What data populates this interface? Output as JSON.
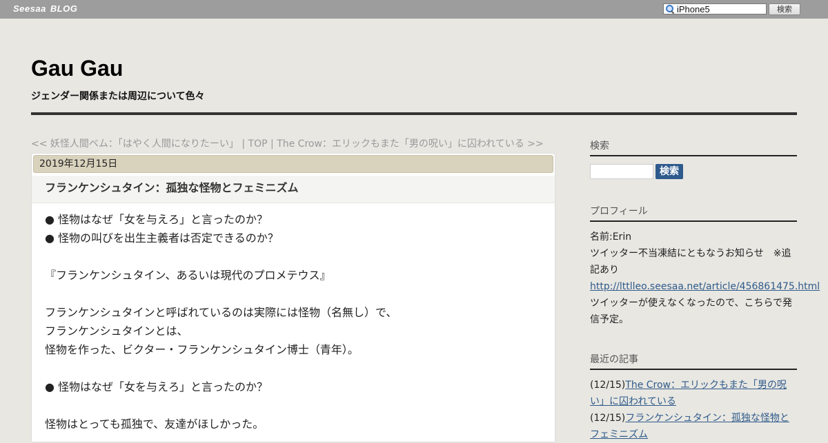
{
  "topbar": {
    "brand_word1": "Seesaa",
    "brand_word2": "BLOG",
    "search_value": "iPhone5",
    "search_button": "検索"
  },
  "header": {
    "title": "Gau Gau",
    "description": "ジェンダー関係または周辺について色々"
  },
  "article_nav": {
    "prev": "<< 妖怪人間ベム：「はやく人間になりたーい」",
    "sep1": " | ",
    "top": "TOP",
    "sep2": " | ",
    "next": "The Crow：エリックもまた「男の呪い」に囚われている >>"
  },
  "article": {
    "date": "2019年12月15日",
    "title": "フランケンシュタイン：孤独な怪物とフェミニズム",
    "body_lines": [
      "● 怪物はなぜ「女を与えろ」と言ったのか？",
      "● 怪物の叫びを出生主義者は否定できるのか？",
      "",
      "『フランケンシュタイン、あるいは現代のプロメテウス』",
      "",
      "フランケンシュタインと呼ばれているのは実際には怪物（名無し）で、",
      "フランケンシュタインとは、",
      "怪物を作った、ビクター・フランケンシュタイン博士（青年）。",
      "",
      "● 怪物はなぜ「女を与えろ」と言ったのか？",
      "",
      "怪物はとっても孤独で、友達がほしかった。"
    ]
  },
  "sidebar": {
    "search": {
      "heading": "検索",
      "button": "検索"
    },
    "profile": {
      "heading": "プロフィール",
      "name": "名前:Erin",
      "notice": "ツイッター不当凍結にともなうお知らせ　※追記あり",
      "link": "http://lttlleo.seesaa.net/article/456861475.html",
      "note": "ツイッターが使えなくなったので、こちらで発信予定。"
    },
    "recent": {
      "heading": "最近の記事",
      "items": [
        {
          "date": "(12/15)",
          "title": "The Crow：エリックもまた「男の呪い」に囚われている"
        },
        {
          "date": "(12/15)",
          "title": "フランケンシュタイン：孤独な怪物とフェミニズム"
        }
      ]
    }
  },
  "colors": {
    "topbar": "#9d9d9d",
    "background": "#e8e7e2",
    "date_bar": "#d9d3bd",
    "link": "#2f5a8a",
    "search_button": "#2e5a8c"
  }
}
